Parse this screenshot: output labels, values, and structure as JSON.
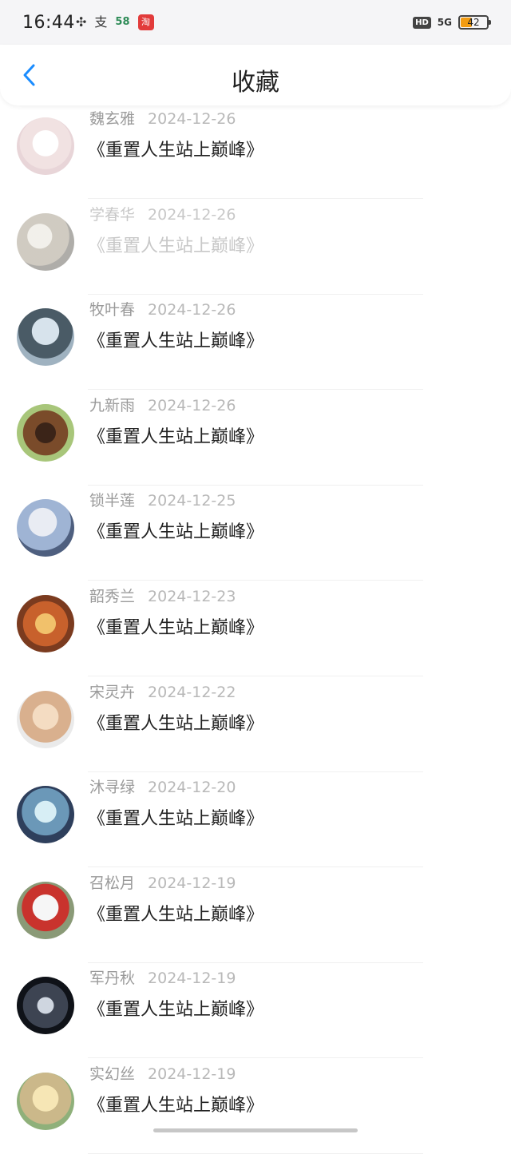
{
  "status_bar": {
    "time": "16:44",
    "icons": [
      "pinwheel-icon",
      "alipay-icon",
      "58-icon",
      "taobao-icon"
    ],
    "icon_glyphs": [
      "✣",
      "支",
      "58",
      "淘"
    ],
    "hd": "HD",
    "network": "5G",
    "battery": "42",
    "battery_level": 0.42
  },
  "header": {
    "title": "收藏",
    "back_icon": "chevron-left-icon"
  },
  "favorites": [
    {
      "name": "魏玄雅",
      "date": "2024-12-26",
      "title": "《重置人生站上巅峰》"
    },
    {
      "name": "学春华",
      "date": "2024-12-26",
      "title": "《重置人生站上巅峰》"
    },
    {
      "name": "牧叶春",
      "date": "2024-12-26",
      "title": "《重置人生站上巅峰》"
    },
    {
      "name": "九新雨",
      "date": "2024-12-26",
      "title": "《重置人生站上巅峰》"
    },
    {
      "name": "锁半莲",
      "date": "2024-12-25",
      "title": "《重置人生站上巅峰》"
    },
    {
      "name": "韶秀兰",
      "date": "2024-12-23",
      "title": "《重置人生站上巅峰》"
    },
    {
      "name": "宋灵卉",
      "date": "2024-12-22",
      "title": "《重置人生站上巅峰》"
    },
    {
      "name": "沐寻绿",
      "date": "2024-12-20",
      "title": "《重置人生站上巅峰》"
    },
    {
      "name": "召松月",
      "date": "2024-12-19",
      "title": "《重置人生站上巅峰》"
    },
    {
      "name": "军丹秋",
      "date": "2024-12-19",
      "title": "《重置人生站上巅峰》"
    },
    {
      "name": "实幻丝",
      "date": "2024-12-19",
      "title": "《重置人生站上巅峰》"
    }
  ],
  "colors": {
    "accent": "#1a8cff",
    "title_text": "#222222",
    "meta_text": "#9a9a9a"
  }
}
